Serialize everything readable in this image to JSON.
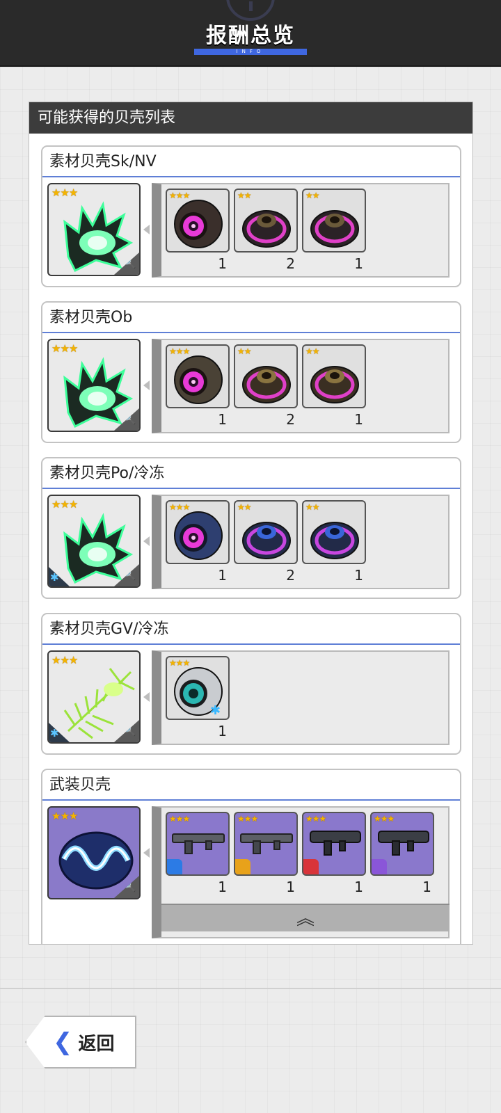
{
  "header": {
    "title": "报酬总览",
    "subtitle": "INFO"
  },
  "panel": {
    "title": "可能获得的贝壳列表"
  },
  "cards": [
    {
      "name": "素材贝壳Sk/NV",
      "freeze": false,
      "items": [
        {
          "kind": "orb",
          "stars": "★★★",
          "count": "1"
        },
        {
          "kind": "gear",
          "stars": "★★",
          "count": "2"
        },
        {
          "kind": "gear",
          "stars": "★★",
          "count": "1"
        }
      ]
    },
    {
      "name": "素材贝壳Ob",
      "freeze": false,
      "items": [
        {
          "kind": "orb",
          "stars": "★★★",
          "count": "1"
        },
        {
          "kind": "gear",
          "stars": "★★",
          "count": "2"
        },
        {
          "kind": "gear",
          "stars": "★★",
          "count": "1"
        }
      ]
    },
    {
      "name": "素材贝壳Po/冷冻",
      "freeze": true,
      "items": [
        {
          "kind": "orb-blue",
          "stars": "★★★",
          "count": "1"
        },
        {
          "kind": "gear-blue",
          "stars": "★★",
          "count": "2"
        },
        {
          "kind": "gear-blue",
          "stars": "★★",
          "count": "1"
        }
      ]
    },
    {
      "name": "素材贝壳GV/冷冻",
      "freeze": true,
      "items": [
        {
          "kind": "orb-cyan",
          "stars": "★★★",
          "count": "1"
        }
      ]
    },
    {
      "name": "武装贝壳",
      "freeze": false,
      "items": [
        {
          "kind": "rifle",
          "stars": "★★★",
          "count": "1"
        },
        {
          "kind": "rifle",
          "stars": "★★★",
          "count": "1"
        },
        {
          "kind": "launcher",
          "stars": "★★★",
          "count": "1"
        },
        {
          "kind": "launcher",
          "stars": "★★★",
          "count": "1"
        }
      ]
    }
  ],
  "shell_stars": "★★★",
  "icons": {
    "magnify": "🔍",
    "freeze": "✱",
    "collapse": "︽",
    "back": "❮"
  },
  "back_button": {
    "label": "返回"
  }
}
